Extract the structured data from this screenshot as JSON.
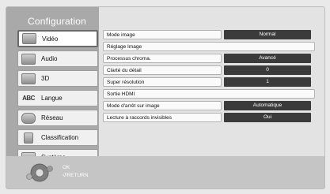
{
  "title": "Configuration",
  "menu": [
    {
      "label": "Vidéo",
      "icon": "video-icon",
      "selected": true
    },
    {
      "label": "Audio",
      "icon": "audio-icon",
      "selected": false
    },
    {
      "label": "3D",
      "icon": "3d-icon",
      "selected": false
    },
    {
      "label": "Langue",
      "icon": "language-icon",
      "icon_text": "ABC",
      "selected": false
    },
    {
      "label": "Réseau",
      "icon": "network-icon",
      "selected": false
    },
    {
      "label": "Classification",
      "icon": "lock-icon",
      "selected": false
    },
    {
      "label": "Système",
      "icon": "system-icon",
      "selected": false
    }
  ],
  "settings": [
    {
      "label": "Mode image",
      "value": "Normal"
    },
    {
      "label": "Réglage Image",
      "value": null
    },
    {
      "label": "Processus chroma.",
      "value": "Avancé"
    },
    {
      "label": "Clarté du détail",
      "value": "0"
    },
    {
      "label": "Super résolution",
      "value": "1"
    },
    {
      "label": "Sortie HDMI",
      "value": null
    },
    {
      "label": "Mode d'arrêt sur image",
      "value": "Automatique"
    },
    {
      "label": "Lecture à raccords invisibles",
      "value": "Oui"
    }
  ],
  "footer": {
    "ok_label": "OK",
    "return_label": "RETURN"
  },
  "colors": {
    "left_pane": "#a9a9a9",
    "right_pane": "#e3e3e3",
    "value_cell": "#3b3b3b",
    "selected_border": "#6a6a6a"
  }
}
